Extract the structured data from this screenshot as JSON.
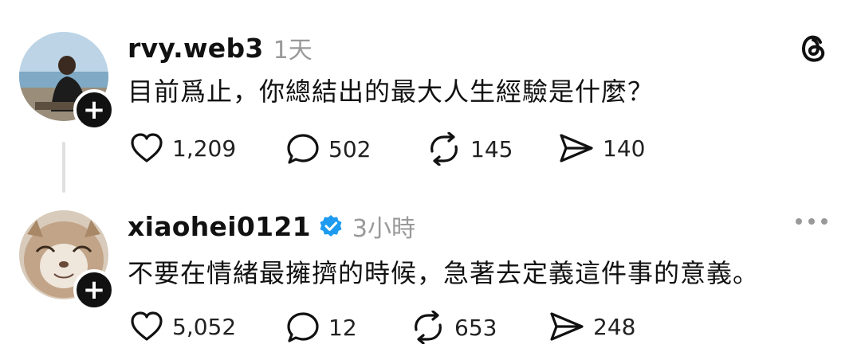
{
  "app": {
    "logo_icon": "threads-logo-icon"
  },
  "posts": [
    {
      "username": "rvy.web3",
      "timestamp": "1天",
      "verified": false,
      "text": "目前爲止，你總結出的最大人生經驗是什麼？",
      "likes": "1,209",
      "comments": "502",
      "reposts": "145",
      "shares": "140"
    },
    {
      "username": "xiaohei0121",
      "timestamp": "3小時",
      "verified": true,
      "text": "不要在情緒最擁擠的時候，急著去定義這件事的意義。",
      "likes": "5,052",
      "comments": "12",
      "reposts": "653",
      "shares": "248"
    }
  ],
  "colors": {
    "verified": "#1d9bf0",
    "muted": "#999999",
    "text": "#111111"
  }
}
